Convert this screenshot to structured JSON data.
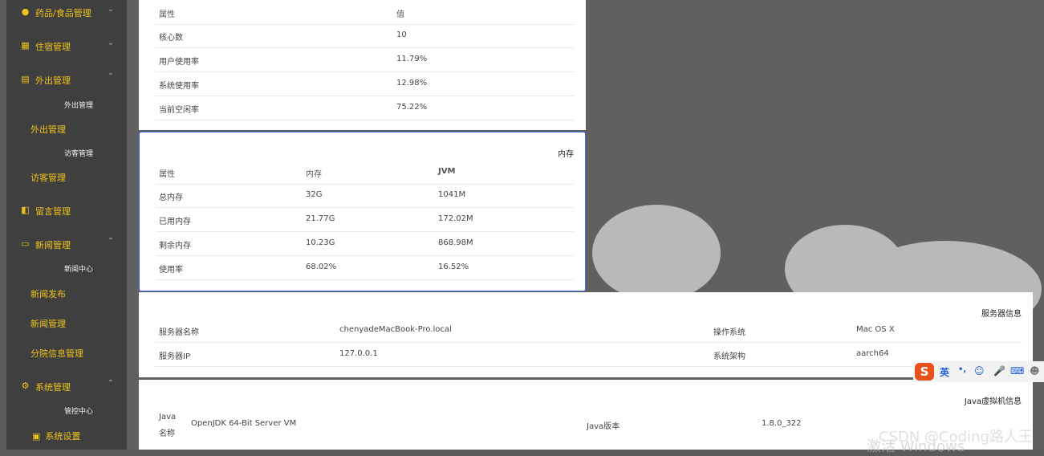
{
  "sidebar": {
    "items": [
      {
        "label": "药品/食品管理",
        "icon": "user-icon"
      },
      {
        "label": "住宿管理",
        "icon": "grid-icon"
      },
      {
        "label": "外出管理",
        "icon": "doc-icon"
      },
      {
        "label": "留言管理",
        "icon": "note-icon"
      },
      {
        "label": "新闻管理",
        "icon": "news-icon"
      },
      {
        "label": "系统管理",
        "icon": "gear-icon"
      }
    ],
    "sub": {
      "out_sub": "外出管理",
      "out_mid": "外出管理",
      "visitor_sub": "访客管理",
      "visitor_mid": "访客管理",
      "news_center": "新闻中心",
      "news_publish": "新闻发布",
      "news_manage": "新闻管理",
      "branch_info": "分院信息管理",
      "control_center": "管控中心",
      "system_settings": "系统设置"
    }
  },
  "cpu": {
    "headers": [
      "属性",
      "值"
    ],
    "rows": [
      [
        "核心数",
        "10"
      ],
      [
        "用户使用率",
        "11.79%"
      ],
      [
        "系统使用率",
        "12.98%"
      ],
      [
        "当前空闲率",
        "75.22%"
      ]
    ]
  },
  "memory": {
    "title": "内存",
    "headers": [
      "属性",
      "内存",
      "JVM"
    ],
    "rows": [
      [
        "总内存",
        "32G",
        "1041M"
      ],
      [
        "已用内存",
        "21.77G",
        "172.02M"
      ],
      [
        "剩余内存",
        "10.23G",
        "868.98M"
      ],
      [
        "使用率",
        "68.02%",
        "16.52%"
      ]
    ]
  },
  "server": {
    "title": "服务器信息",
    "rows": [
      [
        "服务器名称",
        "chenyadeMacBook-Pro.local",
        "操作系统",
        "Mac OS X"
      ],
      [
        "服务器IP",
        "127.0.0.1",
        "系统架构",
        "aarch64"
      ]
    ]
  },
  "jvm": {
    "title": "Java虚拟机信息",
    "row": [
      "Java",
      "名称",
      "OpenJDK 64-Bit Server VM",
      "Java版本",
      "1.8.0_322"
    ]
  },
  "ime": {
    "lang": "英",
    "punct": "•,"
  },
  "watermark": "CSDN @Coding路人王",
  "watermark2": "激活 Windows"
}
